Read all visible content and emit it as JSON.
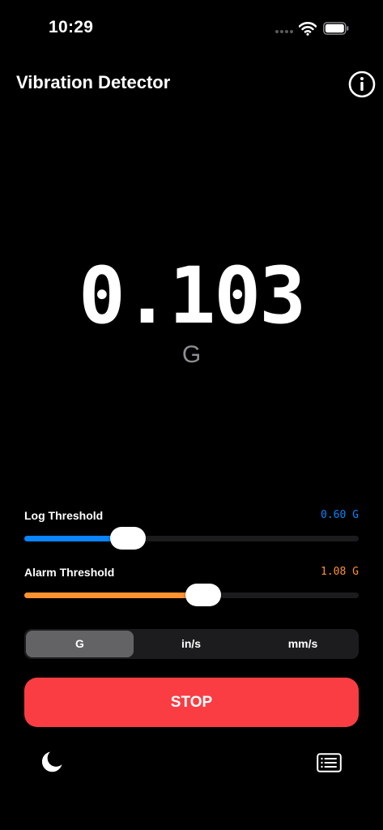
{
  "status_bar": {
    "time": "10:29"
  },
  "header": {
    "title": "Vibration Detector",
    "info_icon": "info-circle-icon"
  },
  "reading": {
    "value": "0.103",
    "unit": "G"
  },
  "log_threshold": {
    "label": "Log Threshold",
    "value": "0.60 G",
    "color": "#0a84ff",
    "level": 0.31
  },
  "alarm_threshold": {
    "label": "Alarm Threshold",
    "value": "1.08 G",
    "color": "#ff9230",
    "level": 0.535
  },
  "unit_segment": {
    "options": [
      "G",
      "in/s",
      "mm/s"
    ],
    "selected": "G"
  },
  "stop_button": {
    "label": "STOP",
    "color": "#fa3d43"
  },
  "bottom_bar": {
    "left_icon": "moon-icon",
    "right_icon": "log-list-icon"
  }
}
